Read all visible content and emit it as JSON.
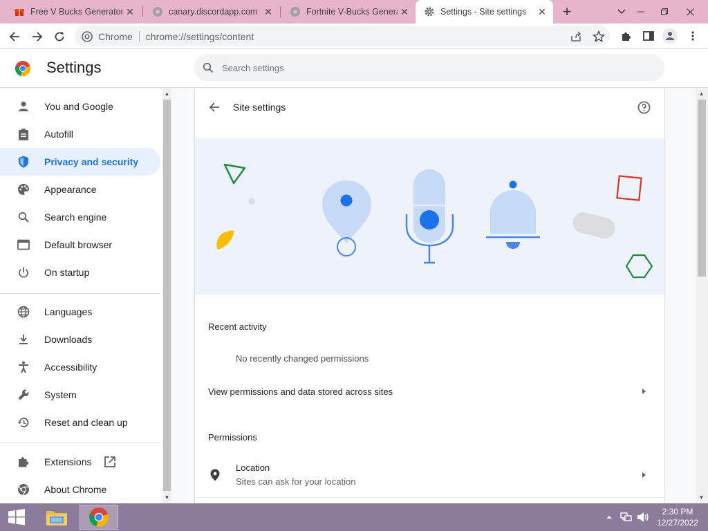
{
  "tabs": [
    {
      "title": "Free V Bucks Generator 2022",
      "icon": "gift-icon",
      "active": false
    },
    {
      "title": "canary.discordapp.com",
      "icon": "globe-icon",
      "active": false
    },
    {
      "title": "Fortnite V-Bucks Generator",
      "icon": "globe-icon",
      "active": false
    },
    {
      "title": "Settings - Site settings",
      "icon": "gear-icon",
      "active": true
    }
  ],
  "tab_close_glyph": "✕",
  "new_tab_glyph": "+",
  "omnibox": {
    "chip": "Chrome",
    "url": "chrome://settings/content"
  },
  "header": {
    "title": "Settings",
    "search_placeholder": "Search settings"
  },
  "sidebar": {
    "items": [
      {
        "label": "You and Google",
        "icon": "person-icon"
      },
      {
        "label": "Autofill",
        "icon": "clipboard-icon"
      },
      {
        "label": "Privacy and security",
        "icon": "shield-icon",
        "active": true
      },
      {
        "label": "Appearance",
        "icon": "palette-icon"
      },
      {
        "label": "Search engine",
        "icon": "search-icon"
      },
      {
        "label": "Default browser",
        "icon": "browser-icon"
      },
      {
        "label": "On startup",
        "icon": "power-icon"
      },
      {
        "label": "Languages",
        "icon": "globe-icon"
      },
      {
        "label": "Downloads",
        "icon": "download-icon"
      },
      {
        "label": "Accessibility",
        "icon": "accessibility-icon"
      },
      {
        "label": "System",
        "icon": "wrench-icon"
      },
      {
        "label": "Reset and clean up",
        "icon": "history-icon"
      },
      {
        "label": "Extensions",
        "icon": "puzzle-icon"
      },
      {
        "label": "About Chrome",
        "icon": "chrome-icon"
      }
    ]
  },
  "main": {
    "title": "Site settings",
    "recent_activity": {
      "heading": "Recent activity",
      "empty_text": "No recently changed permissions"
    },
    "view_permissions": "View permissions and data stored across sites",
    "permissions": {
      "heading": "Permissions",
      "items": [
        {
          "title": "Location",
          "subtitle": "Sites can ask for your location",
          "icon": "location-pin-icon"
        }
      ]
    }
  },
  "taskbar": {
    "time": "2:30 PM",
    "date": "12/27/2022"
  },
  "colors": {
    "accent": "#1a73e8",
    "tabstrip": "#e8b4cc",
    "taskbar": "#8c7b9a"
  }
}
